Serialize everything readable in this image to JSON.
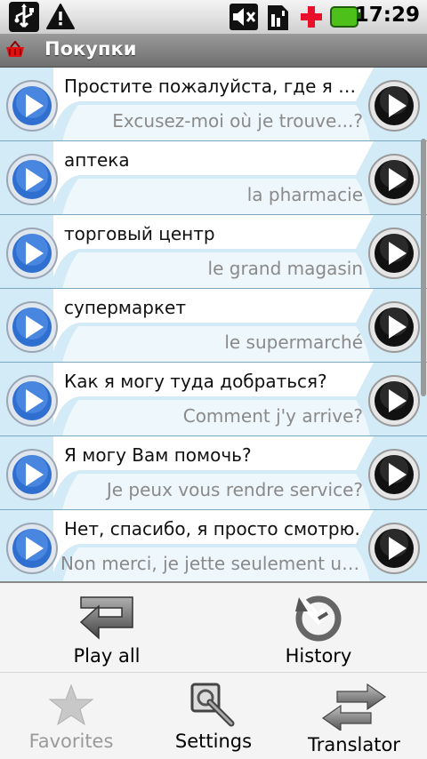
{
  "status_bar": {
    "time": "17:29",
    "icons": [
      "usb-icon",
      "warning-icon",
      "mute-icon",
      "sim-icon",
      "medical-cross-icon",
      "battery-icon"
    ]
  },
  "title_bar": {
    "title": "Покупки",
    "icon": "shopping-basket-icon"
  },
  "phrases": [
    {
      "ru": "Простите пожалуйста, где я могу...",
      "fr": "Excusez-moi où je trouve...?"
    },
    {
      "ru": "аптека",
      "fr": "la pharmacie"
    },
    {
      "ru": "торговый центр",
      "fr": "le grand magasin"
    },
    {
      "ru": "супермаркет",
      "fr": "le supermarché"
    },
    {
      "ru": "Как я могу туда добраться?",
      "fr": "Comment j'y arrive?"
    },
    {
      "ru": "Я могу Вам помочь?",
      "fr": "Je peux vous rendre service?"
    },
    {
      "ru": "Нет, спасибо, я просто смотрю.",
      "fr": "Non merci, je jette seulement un c..."
    }
  ],
  "menu": {
    "play_all": {
      "label": "Play all",
      "icon": "return-arrow-icon"
    },
    "history": {
      "label": "History",
      "icon": "history-icon"
    },
    "favorites": {
      "label": "Favorites",
      "icon": "star-icon",
      "enabled": false
    },
    "settings": {
      "label": "Settings",
      "icon": "wrench-magnifier-icon"
    },
    "translator": {
      "label": "Translator",
      "icon": "swap-arrows-icon"
    }
  }
}
